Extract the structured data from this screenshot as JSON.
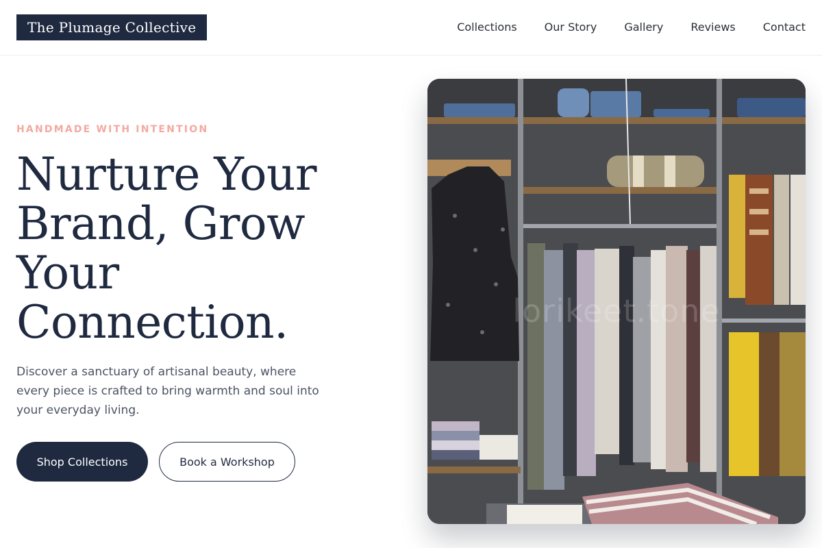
{
  "brand": {
    "name": "The Plumage Collective"
  },
  "nav": {
    "items": [
      {
        "label": "Collections"
      },
      {
        "label": "Our Story"
      },
      {
        "label": "Gallery"
      },
      {
        "label": "Reviews"
      },
      {
        "label": "Contact"
      }
    ]
  },
  "hero": {
    "eyebrow": "HANDMADE WITH INTENTION",
    "headline": "Nurture Your Brand, Grow Your Connection.",
    "subcopy": "Discover a sanctuary of artisanal beauty, where every piece is crafted to bring warmth and soul into your everyday living.",
    "primary_cta": "Shop Collections",
    "secondary_cta": "Book a Workshop",
    "image_watermark": "lorikeet.tone"
  },
  "colors": {
    "navy": "#1f2a40",
    "accent_pink": "#f3a9a0",
    "body_text": "#4a5263",
    "background": "#ffffff"
  }
}
